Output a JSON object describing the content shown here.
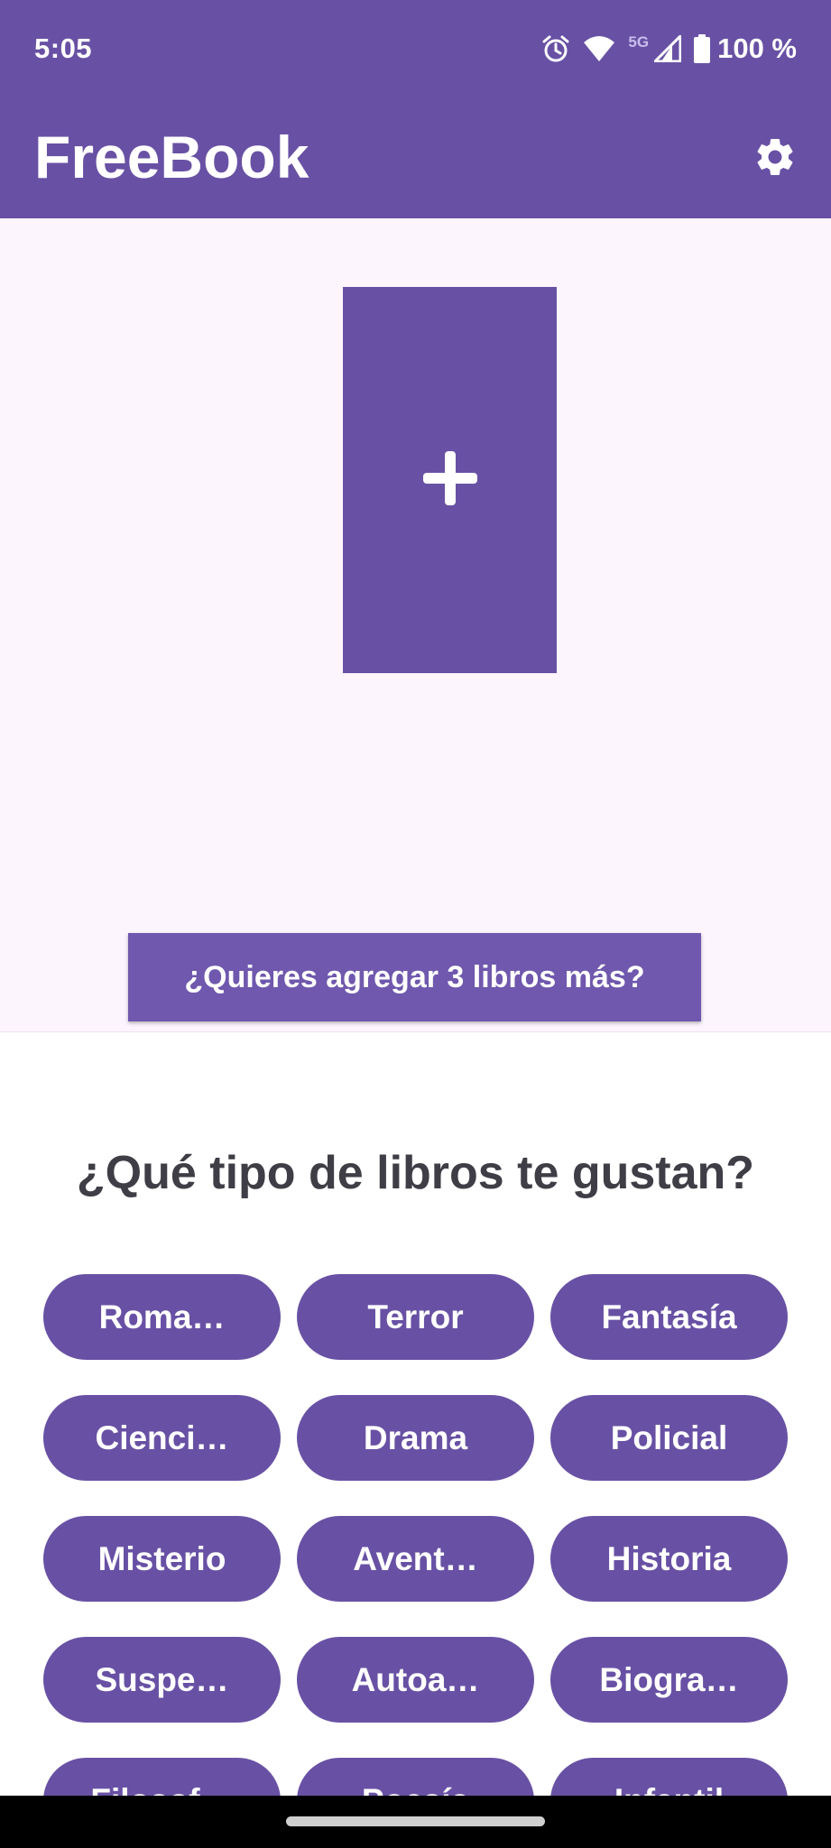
{
  "status_bar": {
    "time": "5:05",
    "network": "5G",
    "battery": "100 %"
  },
  "app_bar": {
    "title": "FreeBook",
    "settings_icon": "gear-icon"
  },
  "hero": {
    "add_icon": "plus-icon",
    "more_books_label": "¿Quieres agregar 3 libros más?"
  },
  "genres": {
    "title": "¿Qué tipo de libros te gustan?",
    "items": [
      "Roma…",
      "Terror",
      "Fantasía",
      "Cienci…",
      "Drama",
      "Policial",
      "Misterio",
      "Avent…",
      "Historia",
      "Suspe…",
      "Autoa…",
      "Biogra…",
      "Filosof…",
      "Poesía",
      "Infantil"
    ]
  },
  "colors": {
    "primary": "#6851a4",
    "hero_background": "#fcf5fe",
    "title_text": "#3f3d45"
  }
}
